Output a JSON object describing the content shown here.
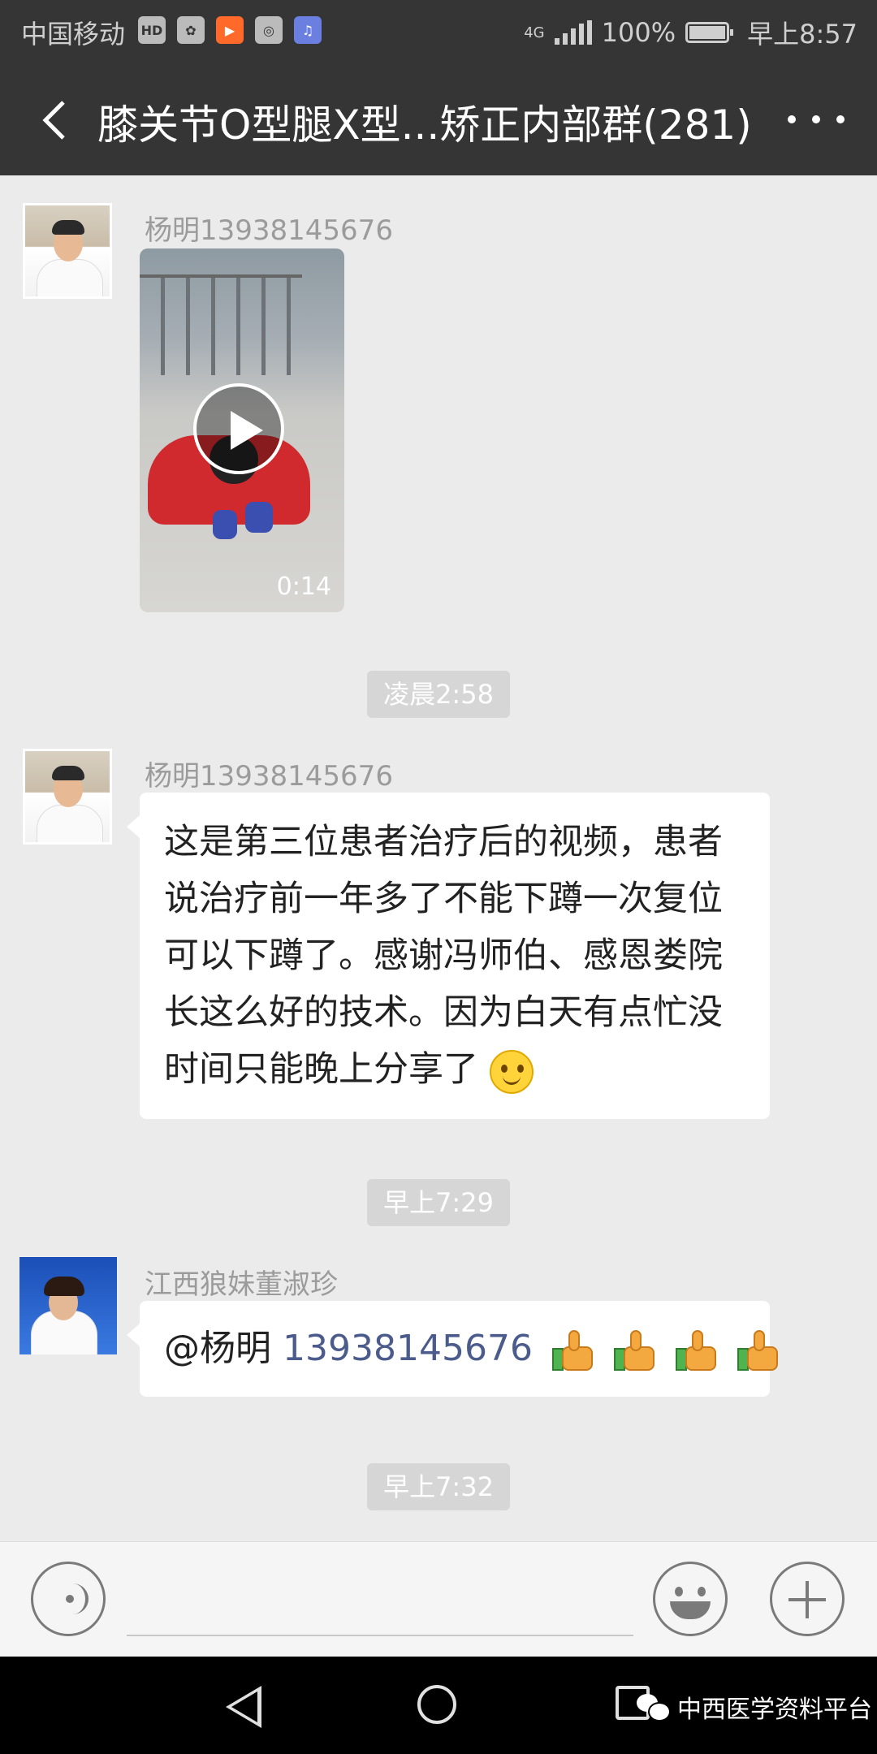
{
  "status_bar": {
    "carrier": "中国移动",
    "network": "4G",
    "battery": "100%",
    "time": "早上8:57",
    "icons": [
      "hd-icon",
      "huawei-icon",
      "video-app-icon",
      "app-icon",
      "music-icon"
    ]
  },
  "title_bar": {
    "title": "膝关节O型腿X型...矫正内部群(281)"
  },
  "messages": [
    {
      "type": "video",
      "sender": "杨明13938145676",
      "duration": "0:14"
    },
    {
      "type": "time",
      "text": "凌晨2:58"
    },
    {
      "type": "text",
      "sender": "杨明13938145676",
      "text": "这是第三位患者治疗后的视频，患者说治疗前一年多了不能下蹲一次复位可以下蹲了。感谢冯师伯、感恩娄院长这么好的技术。因为白天有点忙没时间只能晚上分享了"
    },
    {
      "type": "time",
      "text": "早上7:29"
    },
    {
      "type": "text",
      "sender": "江西狼妹董淑珍",
      "mention": "@杨明",
      "phone": "13938145676"
    },
    {
      "type": "time",
      "text": "早上7:32"
    }
  ],
  "watermark": {
    "text": "中西医学资料平台"
  },
  "colors": {
    "bar": "#353535",
    "chat_bg": "#ebebeb",
    "link": "#4a5b8c"
  }
}
